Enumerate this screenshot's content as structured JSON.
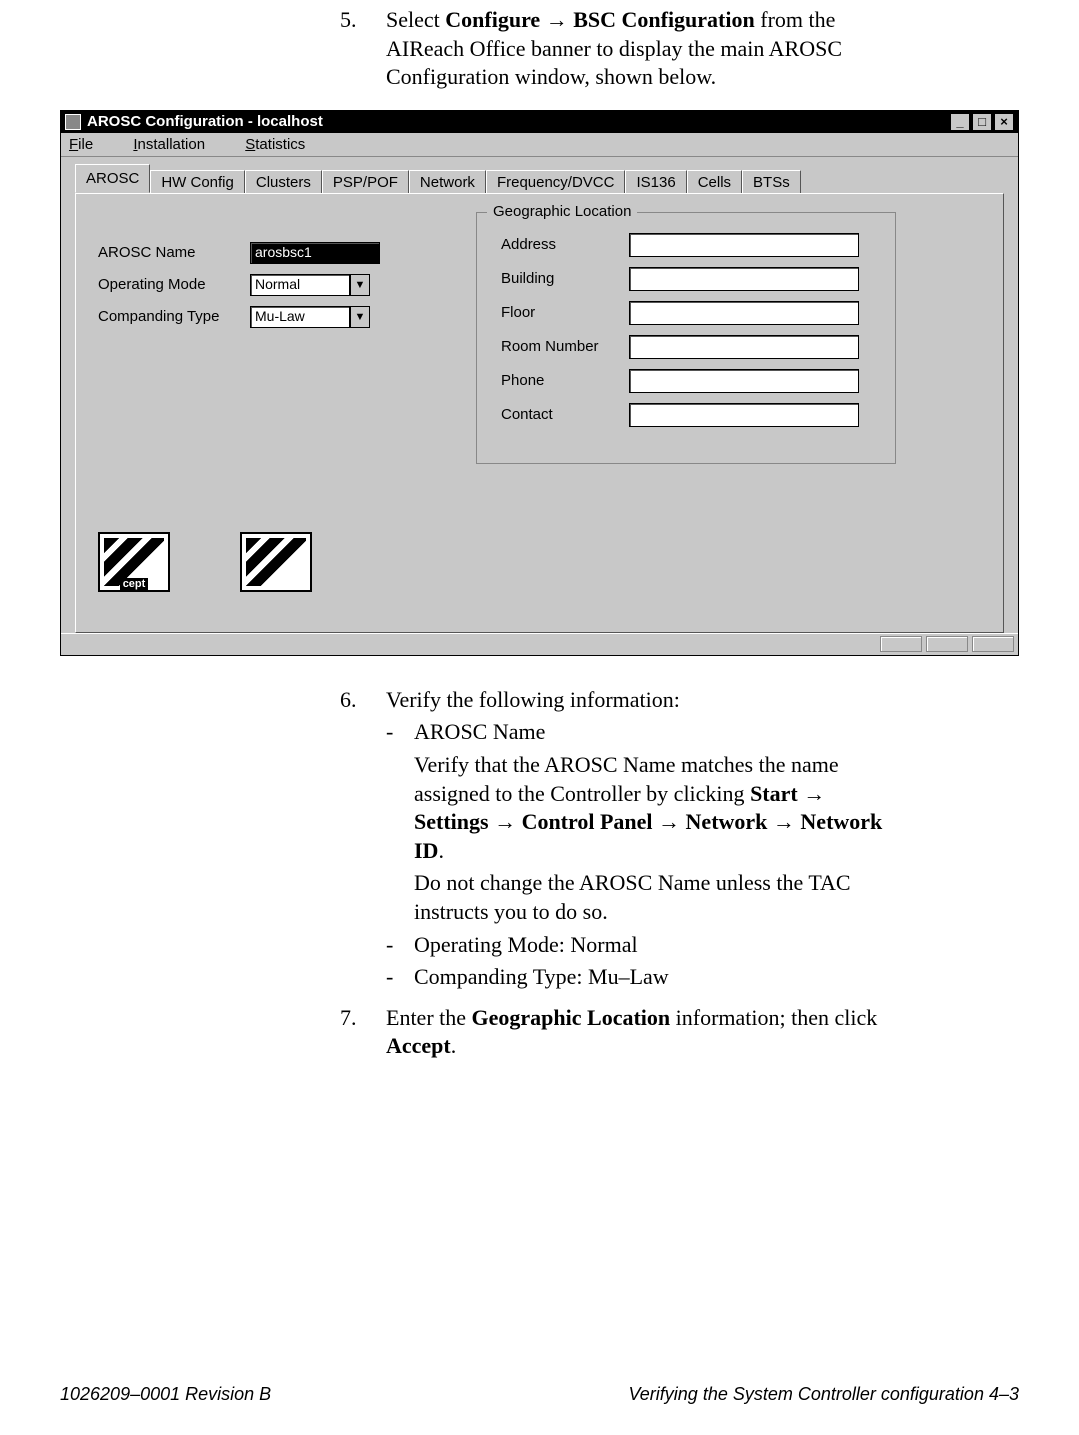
{
  "step5": {
    "num": "5.",
    "line1_a": "Select ",
    "line1_b": "Configure",
    "line1_c": " → ",
    "line1_d": "BSC Configuration",
    "line1_e": " from the AIReach Office banner to display the main AROSC Configuration window, shown below."
  },
  "window": {
    "title": "AROSC Configuration - localhost",
    "menus": {
      "file_u": "F",
      "file_r": "ile",
      "inst_u": "I",
      "inst_r": "nstallation",
      "stat_u": "S",
      "stat_r": "tatistics"
    },
    "tabs": [
      "AROSC",
      "HW Config",
      "Clusters",
      "PSP/POF",
      "Network",
      "Frequency/DVCC",
      "IS136",
      "Cells",
      "BTSs"
    ],
    "activeTab": 0,
    "left": {
      "arosc_label": "AROSC Name",
      "arosc_value": "arosbsc1",
      "opmode_label": "Operating Mode",
      "opmode_value": "Normal",
      "comp_label": "Companding Type",
      "comp_value": "Mu-Law"
    },
    "geo": {
      "legend": "Geographic Location",
      "address": "Address",
      "building": "Building",
      "floor": "Floor",
      "room": "Room Number",
      "phone": "Phone",
      "contact": "Contact"
    },
    "buttons": {
      "accept": "cept",
      "undo": ""
    }
  },
  "step6": {
    "num": "6.",
    "intro": "Verify the following information:",
    "b1": "AROSC Name",
    "b1_p1a": "Verify that the AROSC Name matches the name assigned to the Controller by clicking ",
    "b1_p1b": "Start",
    "b1_p1c": " → ",
    "b1_p1d": "Settings",
    "b1_p1e": " → ",
    "b1_p1f": "Control Panel",
    "b1_p1g": " → ",
    "b1_p1h": "Network",
    "b1_p1i": " → ",
    "b1_p1j": "Network ID",
    "b1_p1k": ".",
    "b1_p2": "Do not change the AROSC Name unless the TAC instructs you to do so.",
    "b2": "Operating Mode: Normal",
    "b3": "Companding Type: Mu–Law"
  },
  "step7": {
    "num": "7.",
    "a": "Enter the ",
    "b": "Geographic Location",
    "c": " information; then click ",
    "d": "Accept",
    "e": "."
  },
  "footer": {
    "left": "1026209–0001  Revision B",
    "right": "Verifying the System Controller configuration   4–3"
  }
}
